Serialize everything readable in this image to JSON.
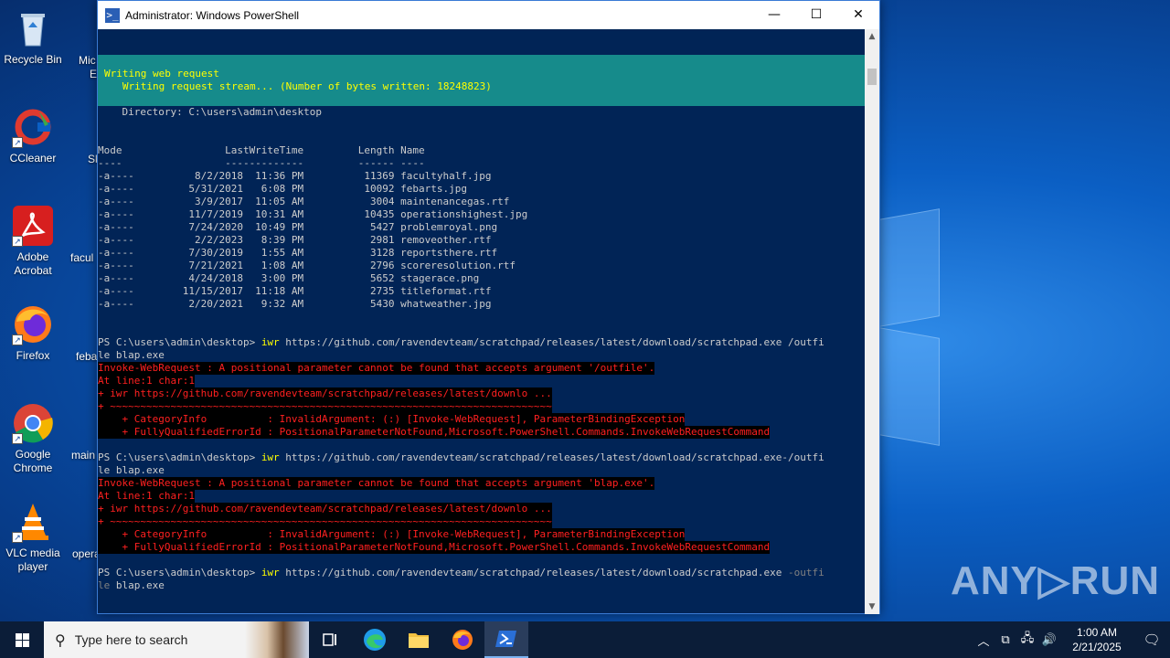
{
  "desktop": {
    "icons": [
      {
        "label": "Recycle Bin"
      },
      {
        "label": "CCleaner"
      },
      {
        "label": "Adobe Acrobat"
      },
      {
        "label": "Firefox"
      },
      {
        "label": "Google Chrome"
      },
      {
        "label": "VLC media player"
      }
    ],
    "peek_labels": [
      "Mic",
      "E",
      "Sk",
      "facul",
      "feba",
      "main",
      "opera"
    ]
  },
  "window": {
    "title": "Administrator: Windows PowerShell",
    "minimize": "—",
    "maximize": "☐",
    "close": "✕"
  },
  "console": {
    "progress": {
      "line1": "Writing web request",
      "line2": "   Writing request stream... (Number of bytes written: 18248823)"
    },
    "directory_line": "    Directory: C:\\users\\admin\\desktop",
    "header": "Mode                 LastWriteTime         Length Name",
    "header_rule": "----                 -------------         ------ ----",
    "files": [
      "-a----          8/2/2018  11:36 PM          11369 facultyhalf.jpg",
      "-a----         5/31/2021   6:08 PM          10092 febarts.jpg",
      "-a----          3/9/2017  11:05 AM           3004 maintenancegas.rtf",
      "-a----         11/7/2019  10:31 AM          10435 operationshighest.jpg",
      "-a----         7/24/2020  10:49 PM           5427 problemroyal.png",
      "-a----          2/2/2023   8:39 PM           2981 removeother.rtf",
      "-a----         7/30/2019   1:55 AM           3128 reportsthere.rtf",
      "-a----         7/21/2021   1:08 AM           2796 scoreresolution.rtf",
      "-a----         4/24/2018   3:00 PM           5652 stagerace.png",
      "-a----        11/15/2017  11:18 AM           2735 titleformat.rtf",
      "-a----         2/20/2021   9:32 AM           5430 whatweather.jpg"
    ],
    "attempt1": {
      "prompt": "PS C:\\users\\admin\\desktop> ",
      "cmd": "iwr",
      "args": " https://github.com/ravendevteam/scratchpad/releases/latest/download/scratchpad.exe /outfi",
      "wrap": "le blap.exe",
      "errors": [
        "Invoke-WebRequest : A positional parameter cannot be found that accepts argument '/outfile'.",
        "At line:1 char:1",
        "+ iwr https://github.com/ravendevteam/scratchpad/releases/latest/downlo ...",
        "+ ~~~~~~~~~~~~~~~~~~~~~~~~~~~~~~~~~~~~~~~~~~~~~~~~~~~~~~~~~~~~~~~~~~~~~~~~~",
        "    + CategoryInfo          : InvalidArgument: (:) [Invoke-WebRequest], ParameterBindingException",
        "    + FullyQualifiedErrorId : PositionalParameterNotFound,Microsoft.PowerShell.Commands.InvokeWebRequestCommand"
      ]
    },
    "attempt2": {
      "prompt": "PS C:\\users\\admin\\desktop> ",
      "cmd": "iwr",
      "args": " https://github.com/ravendevteam/scratchpad/releases/latest/download/scratchpad.exe-/outfi",
      "wrap": "le blap.exe",
      "errors": [
        "Invoke-WebRequest : A positional parameter cannot be found that accepts argument 'blap.exe'.",
        "At line:1 char:1",
        "+ iwr https://github.com/ravendevteam/scratchpad/releases/latest/downlo ...",
        "+ ~~~~~~~~~~~~~~~~~~~~~~~~~~~~~~~~~~~~~~~~~~~~~~~~~~~~~~~~~~~~~~~~~~~~~~~~~",
        "    + CategoryInfo          : InvalidArgument: (:) [Invoke-WebRequest], ParameterBindingException",
        "    + FullyQualifiedErrorId : PositionalParameterNotFound,Microsoft.PowerShell.Commands.InvokeWebRequestCommand"
      ]
    },
    "attempt3": {
      "prompt": "PS C:\\users\\admin\\desktop> ",
      "cmd": "iwr",
      "args": " https://github.com/ravendevteam/scratchpad/releases/latest/download/scratchpad.exe ",
      "param": "-outfi",
      "wrap": "le",
      "wrap_rest": " blap.exe"
    }
  },
  "watermark": "ANY▷RUN",
  "taskbar": {
    "search_placeholder": "Type here to search",
    "clock_time": "1:00 AM",
    "clock_date": "2/21/2025"
  },
  "colors": {
    "console_bg": "#012456",
    "progress_bg": "#168b8b",
    "error_fg": "#ff2020",
    "taskbar_bg": "#0b1d38"
  }
}
